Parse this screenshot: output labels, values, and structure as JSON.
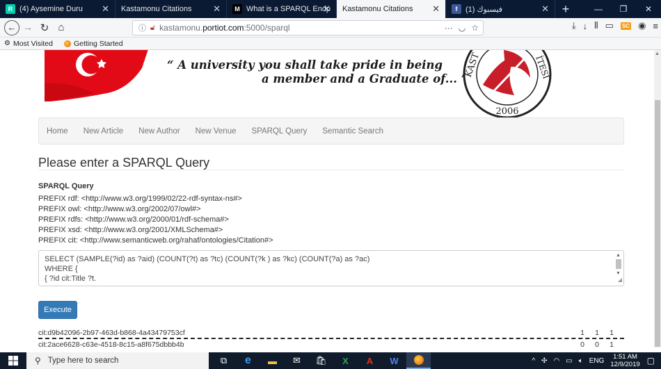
{
  "browser": {
    "tabs": [
      {
        "title": "(4) Aysemine Duru",
        "favicon": "researchgate-icon",
        "active": false
      },
      {
        "title": "Kastamonu Citations",
        "favicon": "",
        "active": false
      },
      {
        "title": "What is a SPARQL Endpoint, ",
        "favicon": "medium-icon",
        "active": false
      },
      {
        "title": "Kastamonu Citations",
        "favicon": "",
        "active": true
      },
      {
        "title": "(1) فيسبوك",
        "favicon": "facebook-icon",
        "active": false
      }
    ],
    "url_prefix": "kastamonu.",
    "url_host": "portiot.com",
    "url_suffix": ":5000/sparql",
    "url_more": "···",
    "bookmarks": [
      {
        "label": "Most Visited",
        "icon": "gear-icon"
      },
      {
        "label": "Getting Started",
        "icon": "firefox-icon"
      }
    ]
  },
  "banner": {
    "motto_line1": "“ A university you shall take pride in being",
    "motto_line2": "a member and a Graduate of... ”",
    "seal_text_left": "KAST",
    "seal_text_right": "İTESİ",
    "seal_year": "2006"
  },
  "nav": {
    "items": [
      "Home",
      "New Article",
      "New Author",
      "New Venue",
      "SPARQL Query",
      "Semantic Search"
    ]
  },
  "main": {
    "title": "Please enter a SPARQL Query",
    "query_label": "SPARQL Query",
    "prefixes": [
      "PREFIX rdf: <http://www.w3.org/1999/02/22-rdf-syntax-ns#>",
      "PREFIX owl: <http://www.w3.org/2002/07/owl#>",
      "PREFIX rdfs: <http://www.w3.org/2000/01/rdf-schema#>",
      "PREFIX xsd: <http://www.w3.org/2001/XMLSchema#>",
      "PREFIX cit: <http://www.semanticweb.org/rahaf/ontologies/Citation#>"
    ],
    "query_lines": [
      "SELECT (SAMPLE(?id) as ?aid) (COUNT(?t) as ?tc) (COUNT(?k ) as ?kc) (COUNT(?a) as ?ac)",
      "WHERE {",
      "{ ?id cit:Title ?t."
    ],
    "execute_label": "Execute",
    "results": [
      {
        "id": "cit:d9b42096-2b97-463d-b868-4a43479753cf",
        "tc": "1",
        "kc": "1",
        "ac": "1"
      },
      {
        "id": "cit:2ace6628-c63e-4518-8c15-a8f675dbbb4b",
        "tc": "0",
        "kc": "0",
        "ac": "1"
      }
    ]
  },
  "taskbar": {
    "search_placeholder": "Type here to search",
    "language": "ENG",
    "time": "1:51 AM",
    "date": "12/9/2019"
  },
  "colors": {
    "primary_button": "#337ab7",
    "tabbar": "#0a1a33",
    "taskbar": "#101c2c",
    "flag_red": "#e30a17"
  }
}
